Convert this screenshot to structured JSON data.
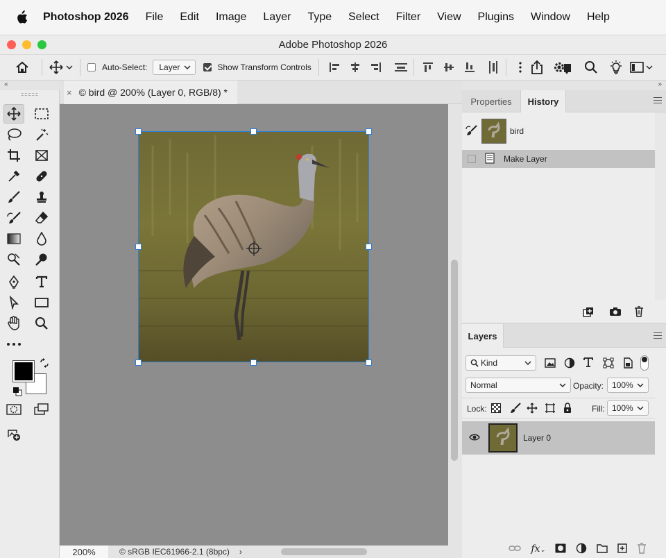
{
  "menubar": {
    "app_name": "Photoshop 2026",
    "items": [
      "File",
      "Edit",
      "Image",
      "Layer",
      "Type",
      "Select",
      "Filter",
      "View",
      "Plugins",
      "Window",
      "Help"
    ]
  },
  "window": {
    "title": "Adobe Photoshop 2026"
  },
  "options_bar": {
    "auto_select_label": "Auto-Select:",
    "auto_select_value": "Layer",
    "show_transform_label": "Show Transform Controls"
  },
  "document": {
    "tab_title": "© bird @ 200% (Layer 0, RGB/8) *",
    "close_glyph": "×"
  },
  "statusbar": {
    "zoom": "200%",
    "profile": "© sRGB IEC61966-2.1 (8bpc)",
    "arrow": "›"
  },
  "panel_top": {
    "tabs": [
      "Properties",
      "History"
    ],
    "snapshot_name": "bird",
    "history_items": [
      "Make Layer"
    ]
  },
  "layers_panel": {
    "tab": "Layers",
    "filter_kind": "Kind",
    "blend_mode": "Normal",
    "opacity_label": "Opacity:",
    "opacity_value": "100%",
    "lock_label": "Lock:",
    "fill_label": "Fill:",
    "fill_value": "100%",
    "layers": [
      {
        "name": "Layer 0",
        "visible": true
      }
    ]
  },
  "colors": {
    "accent": "#2e7fd8",
    "foreground": "#000000",
    "background": "#ffffff",
    "traffic_red": "#ff5f57",
    "traffic_yellow": "#febc2e",
    "traffic_green": "#28c840"
  }
}
